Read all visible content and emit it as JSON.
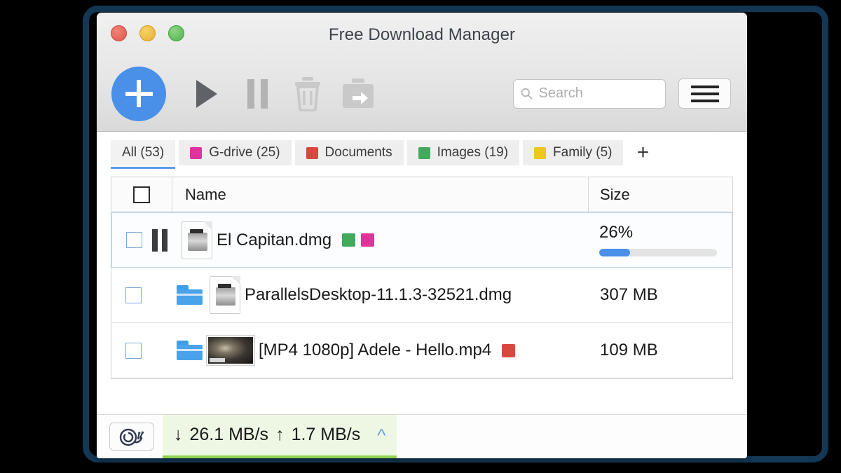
{
  "window": {
    "title": "Free Download Manager",
    "traffic_lights": [
      {
        "name": "close",
        "color": "#e0564b"
      },
      {
        "name": "minimize",
        "color": "#e8b02e"
      },
      {
        "name": "zoom",
        "color": "#4cb44a"
      }
    ]
  },
  "toolbar": {
    "add_label": "+",
    "buttons": [
      {
        "name": "add-download",
        "icon": "plus-icon"
      },
      {
        "name": "start",
        "icon": "play-icon"
      },
      {
        "name": "pause",
        "icon": "pause-icon"
      },
      {
        "name": "delete",
        "icon": "trash-icon"
      },
      {
        "name": "move",
        "icon": "move-to-folder-icon"
      }
    ],
    "search": {
      "placeholder": "Search",
      "value": ""
    },
    "menu_label": "Menu"
  },
  "tabs": [
    {
      "label": "All (53)",
      "color": null,
      "active": true
    },
    {
      "label": "G-drive (25)",
      "color": "#e0329d",
      "active": false
    },
    {
      "label": "Documents",
      "color": "#d6493e",
      "active": false
    },
    {
      "label": "Images (19)",
      "color": "#43a95f",
      "active": false
    },
    {
      "label": "Family (5)",
      "color": "#ecc71d",
      "active": false
    }
  ],
  "tab_add_label": "+",
  "table": {
    "columns": [
      "",
      "Name",
      "Size"
    ],
    "rows": [
      {
        "name": "El Capitan.dmg",
        "size": "",
        "percent_label": "26%",
        "percent_value": 26,
        "state": "paused",
        "icon": "dmg-file-icon",
        "has_folder": false,
        "tags": [
          "#43a95f",
          "#e0329d"
        ],
        "selected": true
      },
      {
        "name": "ParallelsDesktop-11.1.3-32521.dmg",
        "size": "307 MB",
        "percent_label": "",
        "percent_value": null,
        "state": "complete",
        "icon": "dmg-file-icon",
        "has_folder": true,
        "tags": [],
        "selected": false
      },
      {
        "name": "[MP4 1080p] Adele - Hello.mp4",
        "size": "109 MB",
        "percent_label": "",
        "percent_value": null,
        "state": "complete",
        "icon": "video-thumbnail",
        "has_folder": true,
        "tags": [
          "#d6493e"
        ],
        "selected": false
      }
    ]
  },
  "status": {
    "speed_limiter_icon": "snail-icon",
    "download_arrow": "↓",
    "download_speed": "26.1 MB/s",
    "upload_arrow": "↑",
    "upload_speed": "1.7 MB/s",
    "expand_icon": "chevron-up-icon",
    "accent_color": "#8fd04f"
  }
}
